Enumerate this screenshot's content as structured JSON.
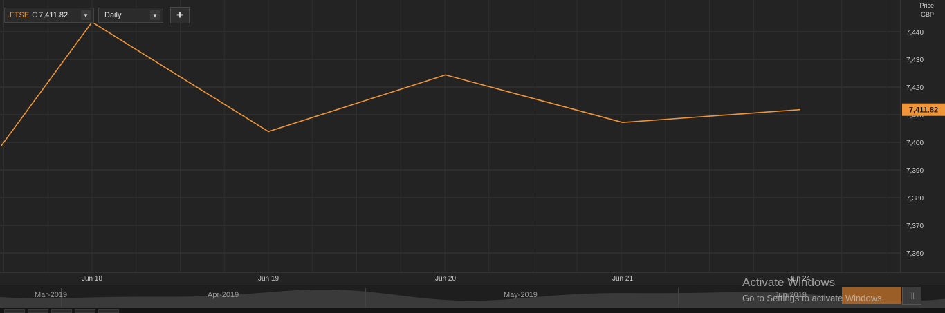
{
  "toolbar": {
    "symbol": ".FTSE",
    "close_prefix": "C",
    "close_value": "7,411.82",
    "interval": "Daily",
    "dropdown_arrow": "▼",
    "add_label": "+"
  },
  "axis_header": {
    "line1": "Price",
    "line2": "GBP"
  },
  "last_price_label": "7,411.82",
  "navigator": {
    "months": [
      "Mar-2019",
      "Apr-2019",
      "May-2019",
      "Jun-2019"
    ]
  },
  "watermark": {
    "title": "Activate Windows",
    "subtitle": "Go to Settings to activate Windows."
  },
  "colors": {
    "line": "#f0963a",
    "background": "#232323",
    "grid": "#3a3a3a",
    "price_tag": "#f0963a"
  },
  "chart_data": {
    "type": "line",
    "title": "",
    "xlabel": "",
    "ylabel": "Price GBP",
    "ylim": [
      7353,
      7449
    ],
    "yticks": [
      7360,
      7370,
      7380,
      7390,
      7400,
      7410,
      7420,
      7430,
      7440
    ],
    "x_tick_labels": [
      "Jun 18",
      "Jun 19",
      "Jun 20",
      "Jun 21",
      "Jun 24"
    ],
    "grid": true,
    "series": [
      {
        "values": [
          7398.8,
          7443.5,
          7403.9,
          7424.4,
          7407.2,
          7411.82
        ]
      }
    ],
    "last_value": 7411.82
  }
}
